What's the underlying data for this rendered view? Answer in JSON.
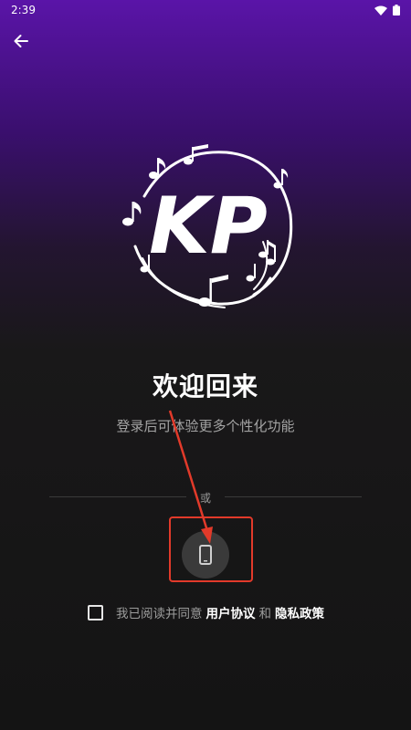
{
  "status_bar": {
    "time": "2:39"
  },
  "header": {
    "back_icon": "arrow-left-icon"
  },
  "logo": {
    "text": "KP"
  },
  "welcome": {
    "title": "欢迎回来",
    "subtitle": "登录后可体验更多个性化功能"
  },
  "divider": {
    "label": "或"
  },
  "login_options": [
    {
      "type": "phone",
      "icon": "smartphone-icon"
    }
  ],
  "agreement": {
    "prefix": "我已阅读并同意",
    "user_agreement": "用户协议",
    "and": "和",
    "privacy_policy": "隐私政策",
    "checked": false
  },
  "colors": {
    "gradient_top": "#5a14a8",
    "background": "#141414",
    "highlight": "#e23a2a"
  }
}
